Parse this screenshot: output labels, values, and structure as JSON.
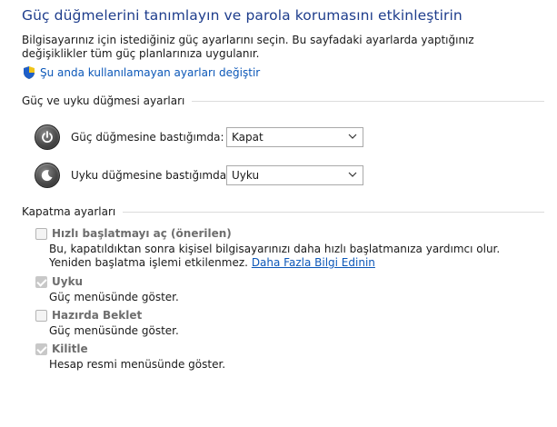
{
  "header": {
    "title": "Güç düğmelerini tanımlayın ve parola korumasını etkinleştirin",
    "intro": "Bilgisayarınız için istediğiniz güç ayarlarını seçin. Bu sayfadaki ayarlarda yaptığınız değişiklikler tüm güç planlarınıza uygulanır.",
    "change_link": "Şu anda kullanılamayan ayarları değiştir",
    "change_link_icon": "uac-shield-icon"
  },
  "power_section": {
    "title": "Güç ve uyku düğmesi ayarları",
    "rows": [
      {
        "label": "Güç düğmesine bastığımda:",
        "value": "Kapat",
        "icon": "power-button-icon"
      },
      {
        "label": "Uyku düğmesine bastığımda:",
        "value": "Uyku",
        "icon": "sleep-button-icon"
      }
    ]
  },
  "shutdown_section": {
    "title": "Kapatma ayarları",
    "items": [
      {
        "label": "Hızlı başlatmayı aç (önerilen)",
        "checked": false,
        "desc": "Bu, kapatıldıktan sonra kişisel bilgisayarınızı daha hızlı başlatmanıza yardımcı olur. Yeniden başlatma işlemi etkilenmez.",
        "link": "Daha Fazla Bilgi Edinin"
      },
      {
        "label": "Uyku",
        "checked": true,
        "desc": "Güç menüsünde göster."
      },
      {
        "label": "Hazırda Beklet",
        "checked": false,
        "desc": "Güç menüsünde göster."
      },
      {
        "label": "Kilitle",
        "checked": true,
        "desc": "Hesap resmi menüsünde göster."
      }
    ]
  },
  "colors": {
    "title": "#1e3d8c",
    "link": "#0b57b8",
    "disabled_label": "#6d6d6d"
  }
}
